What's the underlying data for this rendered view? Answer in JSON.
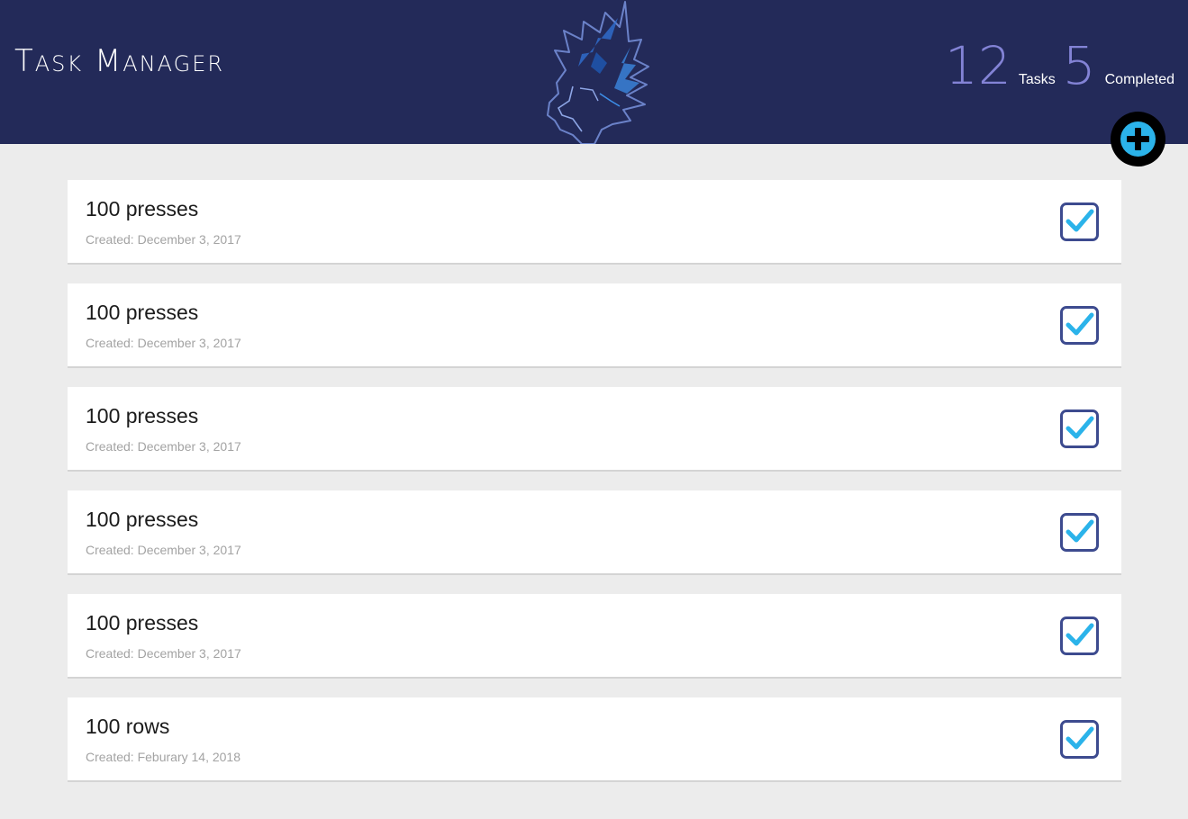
{
  "header": {
    "title": "Task Manager",
    "stats": {
      "tasks_count": "12",
      "tasks_label": "Tasks",
      "completed_count": "5",
      "completed_label": "Completed"
    },
    "logo_icon": "saiyan-head-logo-icon"
  },
  "add_button": {
    "icon": "plus-circle-icon"
  },
  "tasks": [
    {
      "title": "100 presses",
      "created": "Created: December 3, 2017",
      "completed": true
    },
    {
      "title": "100 presses",
      "created": "Created: December 3, 2017",
      "completed": true
    },
    {
      "title": "100 presses",
      "created": "Created: December 3, 2017",
      "completed": true
    },
    {
      "title": "100 presses",
      "created": "Created: December 3, 2017",
      "completed": true
    },
    {
      "title": "100 presses",
      "created": "Created: December 3, 2017",
      "completed": true
    },
    {
      "title": "100 rows",
      "created": "Created: Feburary 14, 2018",
      "completed": true
    }
  ],
  "colors": {
    "header_bg": "#232a59",
    "page_bg": "#ececec",
    "accent": "#2bb3ea",
    "stat_number": "#8383d6",
    "checkbox_border": "#3d4b8f"
  }
}
